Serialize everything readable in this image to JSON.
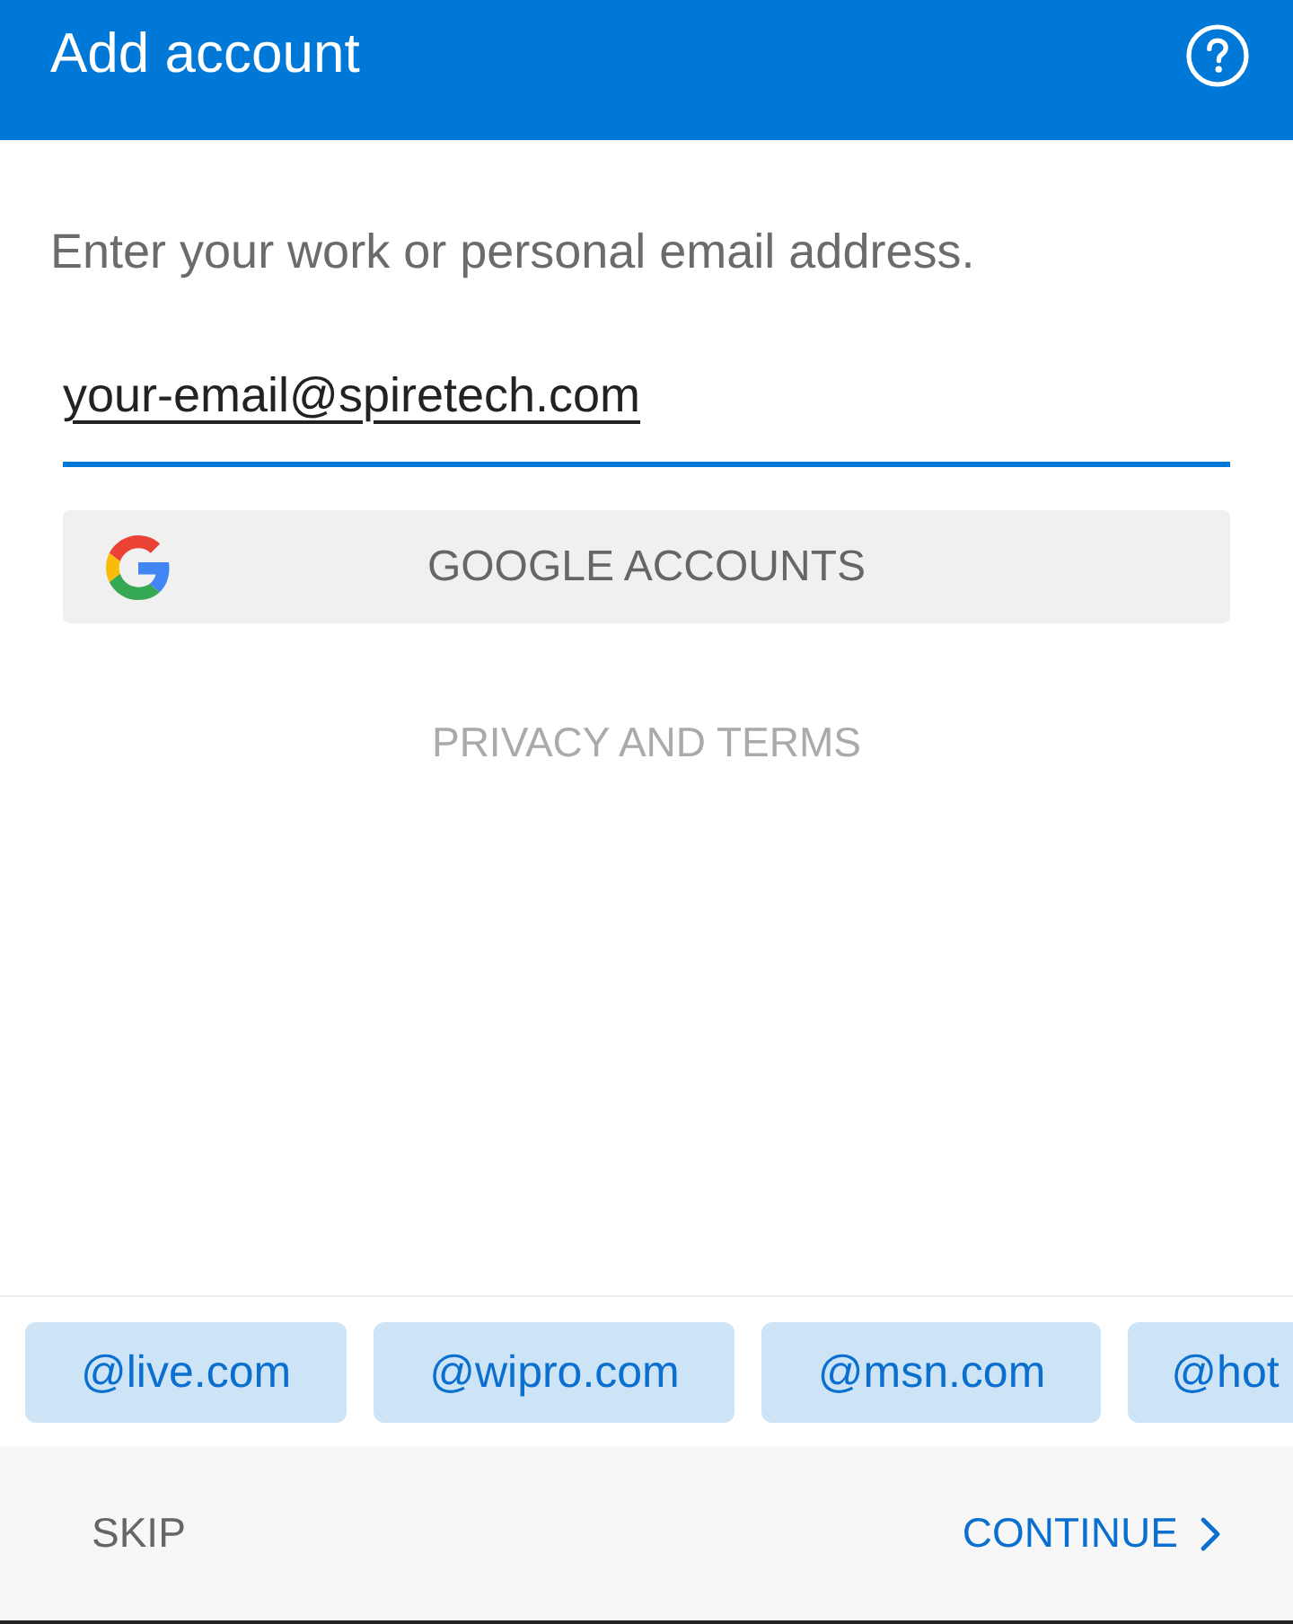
{
  "app_bar": {
    "title": "Add account"
  },
  "prompt": "Enter your work or personal email address.",
  "email_field": {
    "value": "your-email@spiretech.com",
    "focused": true
  },
  "google_button": {
    "label": "GOOGLE ACCOUNTS"
  },
  "privacy_link": {
    "label": "PRIVACY AND TERMS"
  },
  "domain_suggestions": [
    {
      "label": "@live.com"
    },
    {
      "label": "@wipro.com"
    },
    {
      "label": "@msn.com"
    },
    {
      "label": "@hot"
    }
  ],
  "footer": {
    "skip": "SKIP",
    "continue": "CONTINUE"
  }
}
